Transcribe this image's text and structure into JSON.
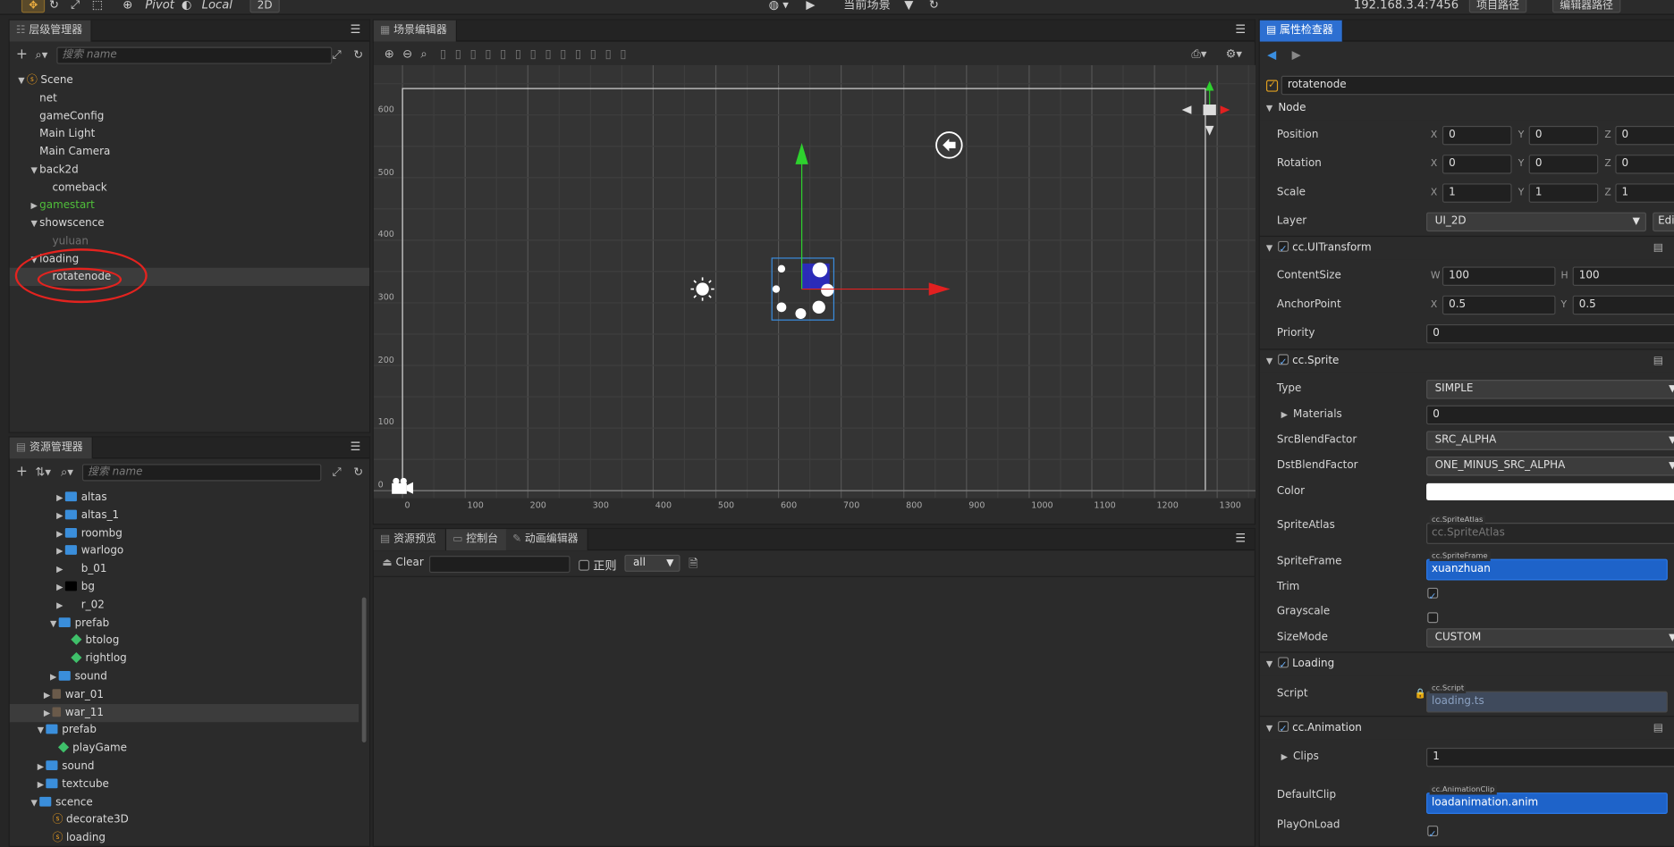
{
  "toolbar": {
    "pivot": "Pivot",
    "local": "Local",
    "mode2d": "2D",
    "scene_select": "当前场景",
    "ip": "192.168.3.4:7456",
    "project_path": "项目路径",
    "editor_path": "编辑器路径"
  },
  "hierarchy": {
    "title": "层级管理器",
    "search_placeholder": "搜索 name",
    "items": [
      {
        "label": "Scene",
        "depth": 0,
        "arrow": "▼",
        "icon": "flame"
      },
      {
        "label": "net",
        "depth": 1,
        "arrow": ""
      },
      {
        "label": "gameConfig",
        "depth": 1,
        "arrow": ""
      },
      {
        "label": "Main Light",
        "depth": 1,
        "arrow": ""
      },
      {
        "label": "Main Camera",
        "depth": 1,
        "arrow": ""
      },
      {
        "label": "back2d",
        "depth": 1,
        "arrow": "▼"
      },
      {
        "label": "comeback",
        "depth": 2,
        "arrow": ""
      },
      {
        "label": "gamestart",
        "depth": 1,
        "arrow": "▶",
        "color": "#4fbf3a"
      },
      {
        "label": "showscence",
        "depth": 1,
        "arrow": "▼"
      },
      {
        "label": "yuluan",
        "depth": 2,
        "arrow": "",
        "color": "#6f6f6f"
      },
      {
        "label": "loading",
        "depth": 1,
        "arrow": "▼"
      },
      {
        "label": "rotatenode",
        "depth": 2,
        "arrow": "",
        "selected": true
      }
    ]
  },
  "assets": {
    "title": "资源管理器",
    "search_placeholder": "搜索 name",
    "items": [
      {
        "label": "altas",
        "depth": 3,
        "arrow": "▶",
        "icon": "folder"
      },
      {
        "label": "altas_1",
        "depth": 3,
        "arrow": "▶",
        "icon": "folder"
      },
      {
        "label": "roombg",
        "depth": 3,
        "arrow": "▶",
        "icon": "folder"
      },
      {
        "label": "warlogo",
        "depth": 3,
        "arrow": "▶",
        "icon": "folder"
      },
      {
        "label": "b_01",
        "depth": 3,
        "arrow": "▶",
        "icon": "none"
      },
      {
        "label": "bg",
        "depth": 3,
        "arrow": "▶",
        "icon": "black"
      },
      {
        "label": "r_02",
        "depth": 3,
        "arrow": "▶",
        "icon": "none"
      },
      {
        "label": "prefab",
        "depth": 2.5,
        "arrow": "▼",
        "icon": "folder"
      },
      {
        "label": "btolog",
        "depth": 3.5,
        "arrow": "",
        "icon": "prefab"
      },
      {
        "label": "rightlog",
        "depth": 3.5,
        "arrow": "",
        "icon": "prefab"
      },
      {
        "label": "sound",
        "depth": 2.5,
        "arrow": "▶",
        "icon": "folder"
      },
      {
        "label": "war_01",
        "depth": 2,
        "arrow": "▶",
        "icon": "img"
      },
      {
        "label": "war_11",
        "depth": 2,
        "arrow": "▶",
        "icon": "img",
        "selected": true
      },
      {
        "label": "prefab",
        "depth": 1.5,
        "arrow": "▼",
        "icon": "folder"
      },
      {
        "label": "playGame",
        "depth": 2.5,
        "arrow": "",
        "icon": "prefab"
      },
      {
        "label": "sound",
        "depth": 1.5,
        "arrow": "▶",
        "icon": "folder"
      },
      {
        "label": "textcube",
        "depth": 1.5,
        "arrow": "▶",
        "icon": "folder"
      },
      {
        "label": "scence",
        "depth": 1,
        "arrow": "▼",
        "icon": "folder"
      },
      {
        "label": "decorate3D",
        "depth": 2,
        "arrow": "",
        "icon": "flame"
      },
      {
        "label": "loading",
        "depth": 2,
        "arrow": "",
        "icon": "flame"
      }
    ]
  },
  "scene": {
    "title": "场景编辑器",
    "y_ticks": [
      "600",
      "500",
      "400",
      "300",
      "200",
      "100",
      "0"
    ],
    "x_ticks": [
      "0",
      "100",
      "200",
      "300",
      "400",
      "500",
      "600",
      "700",
      "800",
      "900",
      "1000",
      "1100",
      "1200",
      "1300"
    ]
  },
  "bottom": {
    "tabs": [
      "资源预览",
      "控制台",
      "动画编辑器"
    ],
    "clear_label": "Clear",
    "regex_label": "正则",
    "filter_value": "all"
  },
  "inspector": {
    "title": "属性检查器",
    "node_name": "rotatenode",
    "node_section": "Node",
    "position_label": "Position",
    "position": {
      "x": "0",
      "y": "0",
      "z": "0"
    },
    "rotation_label": "Rotation",
    "rotation": {
      "x": "0",
      "y": "0",
      "z": "0"
    },
    "scale_label": "Scale",
    "scale": {
      "x": "1",
      "y": "1",
      "z": "1"
    },
    "layer_label": "Layer",
    "layer_value": "UI_2D",
    "edit_label": "Edit",
    "uitransform": "cc.UITransform",
    "contentsize_label": "ContentSize",
    "contentsize": {
      "w": "100",
      "h": "100"
    },
    "anchor_label": "AnchorPoint",
    "anchor": {
      "x": "0.5",
      "y": "0.5"
    },
    "priority_label": "Priority",
    "priority_value": "0",
    "sprite": "cc.Sprite",
    "type_label": "Type",
    "type_value": "SIMPLE",
    "materials_label": "Materials",
    "materials_value": "0",
    "src_label": "SrcBlendFactor",
    "src_value": "SRC_ALPHA",
    "dst_label": "DstBlendFactor",
    "dst_value": "ONE_MINUS_SRC_ALPHA",
    "color_label": "Color",
    "color_value": "#ffffff",
    "atlas_label": "SpriteAtlas",
    "atlas_tag": "cc.SpriteAtlas",
    "atlas_value": "cc.SpriteAtlas",
    "frame_label": "SpriteFrame",
    "frame_tag": "cc.SpriteFrame",
    "frame_value": "xuanzhuan",
    "trim_label": "Trim",
    "grayscale_label": "Grayscale",
    "sizemode_label": "SizeMode",
    "sizemode_value": "CUSTOM",
    "loading": "Loading",
    "script_label": "Script",
    "script_tag": "cc.Script",
    "script_value": "loading.ts",
    "animation": "cc.Animation",
    "clips_label": "Clips",
    "clips_value": "1",
    "defaultclip_label": "DefaultClip",
    "defaultclip_tag": "cc.AnimationClip",
    "defaultclip_value": "loadanimation.anim",
    "playonload_label": "PlayOnLoad",
    "axis": {
      "x": "X",
      "y": "Y",
      "z": "Z",
      "w": "W",
      "h": "H"
    }
  }
}
